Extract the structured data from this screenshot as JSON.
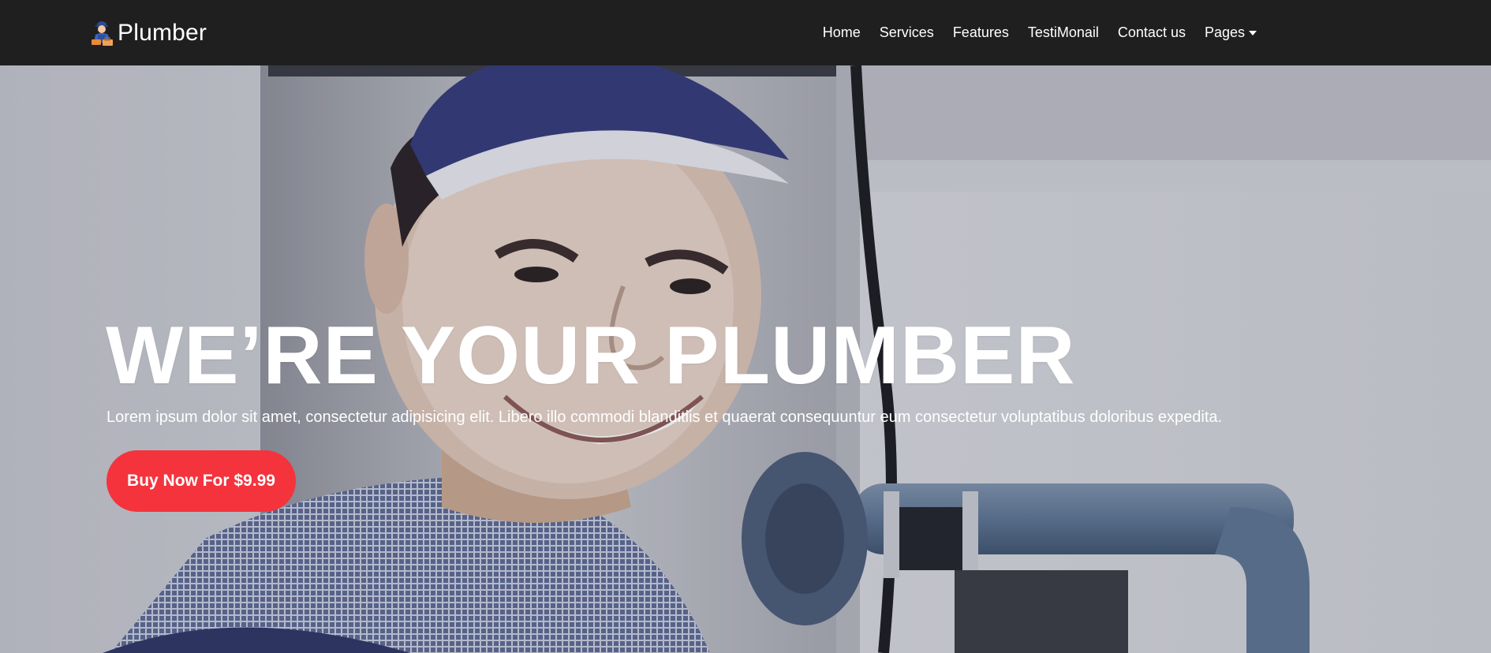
{
  "brand": {
    "name": "Plumber",
    "logo_icon": "plumber-mascot-icon"
  },
  "nav": {
    "items": [
      {
        "label": "Home"
      },
      {
        "label": "Services"
      },
      {
        "label": "Features"
      },
      {
        "label": "TestiMonail"
      },
      {
        "label": "Contact us"
      },
      {
        "label": "Pages",
        "dropdown_icon": "caret-down-icon"
      }
    ]
  },
  "hero": {
    "title": "WE’RE YOUR PLUMBER",
    "subtitle": "Lorem ipsum dolor sit amet, consectetur adipisicing elit. Libero illo commodi blanditiis et quaerat consequuntur eum consectetur voluptatibus doloribus expedita.",
    "cta_label": "Buy Now For $9.99",
    "background_image": "smiling-plumber-with-blue-pipes-photo"
  },
  "colors": {
    "navbar": "#201f20",
    "cta": "#f4333d",
    "text": "#ffffff"
  }
}
